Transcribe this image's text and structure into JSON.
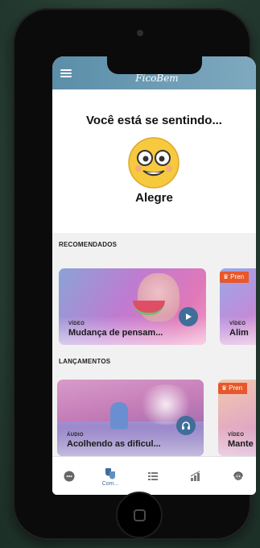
{
  "app": {
    "logo_text": "FicoBem"
  },
  "mood": {
    "title": "Você está se sentindo...",
    "emoji_icon": "flushed-smiley-icon",
    "value": "Alegre"
  },
  "recommended": {
    "title": "RECOMENDADOS",
    "cards": [
      {
        "type": "VÍDEO",
        "label": "Mudança de pensam...",
        "action_icon": "play-icon"
      },
      {
        "type": "VÍDEO",
        "label": "Alim",
        "badge": "Pren",
        "badge_icon": "crown-icon"
      }
    ]
  },
  "launches": {
    "title": "LANÇAMENTOS",
    "cards": [
      {
        "type": "ÁUDIO",
        "label": "Acolhendo as dificul...",
        "action_icon": "headphones-icon"
      },
      {
        "type": "VÍDEO",
        "label": "Mante",
        "badge": "Pren",
        "badge_icon": "crown-icon"
      }
    ]
  },
  "bottom_nav": [
    {
      "icon": "chat-icon",
      "label": ""
    },
    {
      "icon": "theater-masks-icon",
      "label": "Com..."
    },
    {
      "icon": "list-icon",
      "label": ""
    },
    {
      "icon": "chart-icon",
      "label": ""
    },
    {
      "icon": "headset-icon",
      "label": ""
    }
  ],
  "colors": {
    "app_bar": "#5b8ea8",
    "accent": "#3f6e9a",
    "badge": "#e8572b"
  }
}
